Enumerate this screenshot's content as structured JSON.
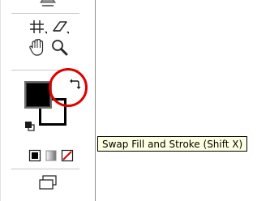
{
  "tooltip": {
    "text": "Swap Fill and Stroke (Shift X)"
  },
  "tools": [
    {
      "name": "free-transform-icon"
    },
    {
      "name": "slice-icon"
    },
    {
      "name": "eraser-icon"
    },
    {
      "name": "hand-icon"
    },
    {
      "name": "zoom-icon"
    }
  ],
  "fill_stroke": {
    "fill_color": "#000000",
    "stroke_color": "#ffffff",
    "swap_icon": "swap-arrow-icon",
    "default_icon": "default-fill-stroke-icon"
  },
  "color_modes": [
    "color-mode-icon",
    "gradient-mode-icon",
    "none-mode-icon"
  ],
  "screen_mode_icon": "screen-mode-icon",
  "annotation": {
    "color": "#e00000"
  },
  "colors": {
    "tooltip_bg": "#ffffe1",
    "panel_edge": "#8f8f8f"
  }
}
